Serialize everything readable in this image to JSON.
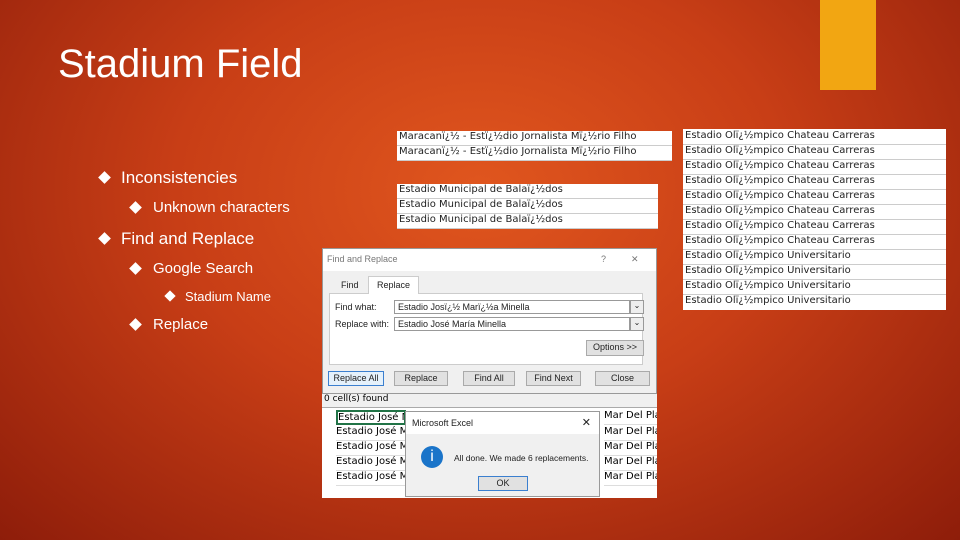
{
  "slide": {
    "title": "Stadium Field",
    "bullets": [
      {
        "text": "Inconsistencies",
        "sub": [
          {
            "text": "Unknown characters"
          }
        ]
      },
      {
        "text": "Find and Replace",
        "sub": [
          {
            "text": "Google Search",
            "sub": [
              {
                "text": "Stadium Name"
              }
            ]
          },
          {
            "text": "Replace"
          }
        ]
      }
    ]
  },
  "table1": [
    "Maracanï¿½ - Estï¿½dio Jornalista Mï¿½rio Filho",
    "Maracanï¿½ - Estï¿½dio Jornalista Mï¿½rio Filho"
  ],
  "table2": [
    "Estadio Municipal de Balaï¿½dos",
    "Estadio Municipal de Balaï¿½dos",
    "Estadio Municipal de Balaï¿½dos"
  ],
  "table3": [
    "Estadio Olï¿½mpico Chateau Carreras",
    "Estadio Olï¿½mpico Chateau Carreras",
    "Estadio Olï¿½mpico Chateau Carreras",
    "Estadio Olï¿½mpico Chateau Carreras",
    "Estadio Olï¿½mpico Chateau Carreras",
    "Estadio Olï¿½mpico Chateau Carreras",
    "Estadio Olï¿½mpico Chateau Carreras",
    "Estadio Olï¿½mpico Chateau Carreras",
    "Estadio Olï¿½mpico Universitario",
    "Estadio Olï¿½mpico Universitario",
    "Estadio Olï¿½mpico Universitario",
    "Estadio Olï¿½mpico Universitario"
  ],
  "find_replace": {
    "title": "Find and Replace",
    "help": "?",
    "close": "✕",
    "tab_find": "Find",
    "tab_replace": "Replace",
    "find_label": "Find what:",
    "find_value": "Estadio Josï¿½ Marï¿½a Minella",
    "replace_label": "Replace with:",
    "replace_value": "Estadio José María Minella",
    "options": "Options >>",
    "replace_all": "Replace All",
    "replace": "Replace",
    "find_all": "Find All",
    "find_next": "Find Next",
    "close_btn": "Close"
  },
  "excel": {
    "status": "0 cell(s) found",
    "col_a": "Estadio José M",
    "col_b": "Mar Del Pla"
  },
  "message": {
    "title": "Microsoft Excel",
    "close": "✕",
    "icon": "i",
    "text": "All done. We made 6 replacements.",
    "ok": "OK"
  }
}
